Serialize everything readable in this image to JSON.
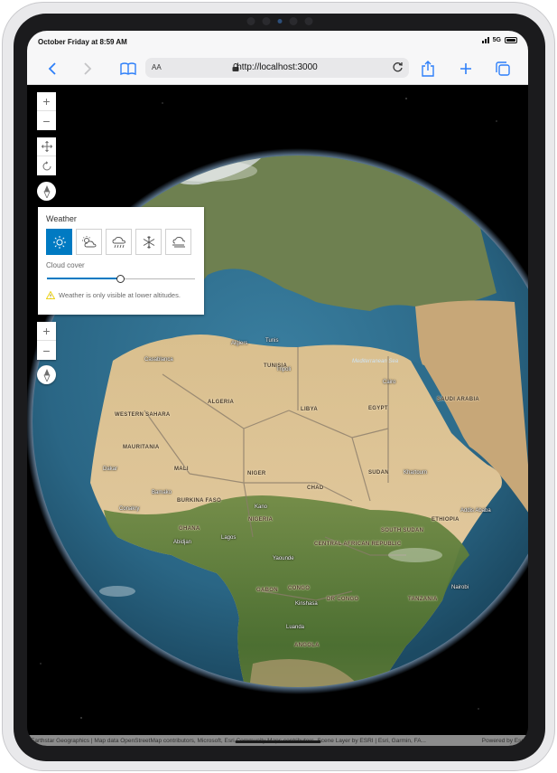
{
  "status_bar": {
    "time": "October Friday at 8:59 AM",
    "network": "5G"
  },
  "browser": {
    "text_size_label": "AA",
    "url": "http://localhost:3000",
    "back_icon": "chevron-left-icon",
    "forward_icon": "chevron-right-icon",
    "bookmarks_icon": "book-icon",
    "share_icon": "share-icon",
    "new_tab_icon": "plus-icon",
    "tabs_icon": "tabs-icon"
  },
  "map_controls": {
    "zoom_in": "+",
    "zoom_out": "−",
    "pan_icon": "move-icon",
    "rotate_icon": "rotate-icon",
    "compass_icon": "compass-icon"
  },
  "weather": {
    "title": "Weather",
    "options": [
      "sunny",
      "cloudy",
      "rainy",
      "snowy",
      "foggy"
    ],
    "selected": "sunny",
    "cloud_cover_label": "Cloud cover",
    "cloud_cover_value": 0.5,
    "warning": "Weather is only visible at lower altitudes."
  },
  "map_labels": {
    "countries": [
      "ALGERIA",
      "LIBYA",
      "EGYPT",
      "MALI",
      "NIGER",
      "CHAD",
      "SUDAN",
      "NIGERIA",
      "MAURITANIA",
      "WESTERN SAHARA",
      "SAUDI ARABIA",
      "ETHIOPIA",
      "SOUTH SUDAN",
      "CENTRAL AFRICAN REPUBLIC",
      "DR CONGO",
      "CONGO",
      "GABON",
      "ANGOLA",
      "TANZANIA",
      "BURKINA FASO",
      "GHANA",
      "TUNISIA"
    ],
    "cities": [
      "Algiers",
      "Tunis",
      "Tripoli",
      "Cairo",
      "Casablanca",
      "Bamako",
      "Kano",
      "Lagos",
      "Abidjan",
      "Conakry",
      "Yaounde",
      "Kinshasa",
      "Luanda",
      "Khartoum",
      "Addis Ababa",
      "Nairobi",
      "Dakar"
    ],
    "seas": [
      "Mediterranean Sea"
    ]
  },
  "attribution": {
    "text": "Earthstar Geographics | Map data OpenStreetMap contributors, Microsoft, Esri Community Maps contributors, Scene Layer by ESRI | Esri, Garmin, FA...",
    "powered_by": "Powered by Esri"
  },
  "colors": {
    "accent": "#007ac2",
    "safari_blue": "#2d7ff9",
    "warning": "#edd317"
  }
}
